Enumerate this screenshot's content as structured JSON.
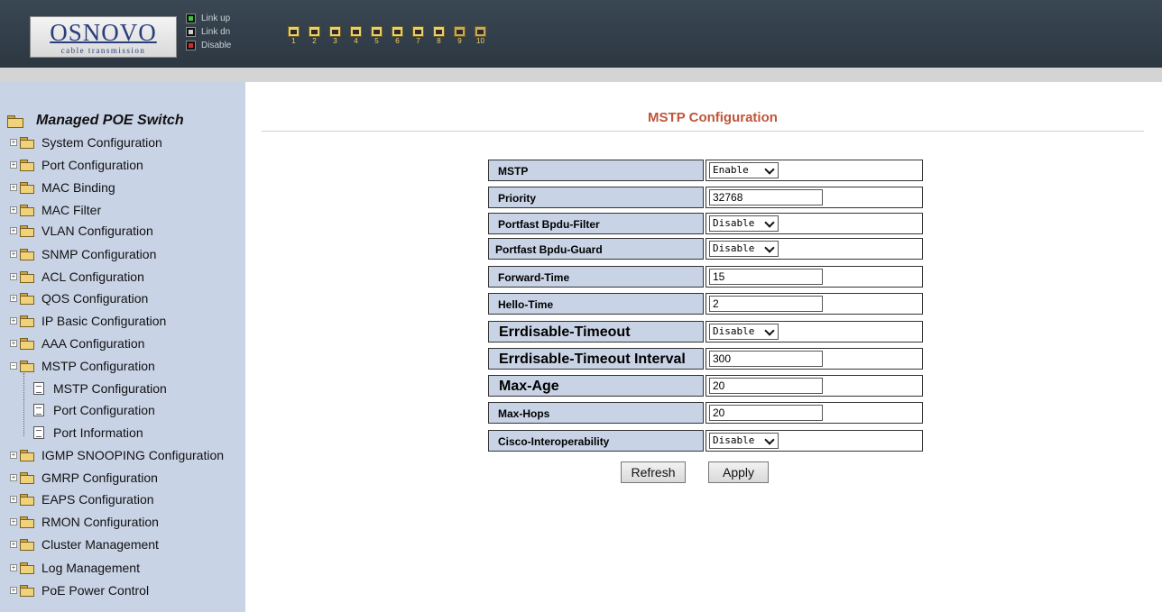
{
  "header": {
    "logo": "OSNOVO",
    "logo_subtitle": "cable transmission",
    "legend": [
      {
        "label": "Link up",
        "icon": "port-link-up-icon"
      },
      {
        "label": "Link dn",
        "icon": "port-link-down-icon"
      },
      {
        "label": "Disable",
        "icon": "port-disabled-icon"
      }
    ],
    "ports": [
      "1",
      "2",
      "3",
      "4",
      "5",
      "6",
      "7",
      "8",
      "9",
      "10"
    ]
  },
  "sidebar": {
    "root_label": "Managed POE Switch",
    "items": [
      {
        "label": "System Configuration"
      },
      {
        "label": "Port Configuration"
      },
      {
        "label": "MAC Binding"
      },
      {
        "label": "MAC Filter"
      },
      {
        "label": "VLAN Configuration"
      },
      {
        "label": "SNMP Configuration"
      },
      {
        "label": "ACL Configuration"
      },
      {
        "label": "QOS Configuration"
      },
      {
        "label": "IP Basic Configuration"
      },
      {
        "label": "AAA Configuration"
      },
      {
        "label": "MSTP Configuration",
        "expanded": true
      },
      {
        "label": "MSTP Configuration"
      },
      {
        "label": "Port Configuration"
      },
      {
        "label": "Port Information"
      },
      {
        "label": "IGMP SNOOPING Configuration"
      },
      {
        "label": "GMRP Configuration"
      },
      {
        "label": "EAPS Configuration"
      },
      {
        "label": "RMON Configuration"
      },
      {
        "label": "Cluster Management"
      },
      {
        "label": "Log Management"
      },
      {
        "label": "PoE Power Control"
      }
    ]
  },
  "main": {
    "title": "MSTP Configuration",
    "rows": [
      {
        "label": "MSTP",
        "type": "select",
        "value": "Enable"
      },
      {
        "label": "Priority",
        "type": "input",
        "value": "32768"
      },
      {
        "label": "Portfast Bpdu-Filter",
        "type": "select",
        "value": "Disable"
      },
      {
        "label": "Portfast Bpdu-Guard",
        "type": "select",
        "value": "Disable"
      },
      {
        "label": "Forward-Time",
        "type": "input",
        "value": "15"
      },
      {
        "label": "Hello-Time",
        "type": "input",
        "value": "2"
      },
      {
        "label": "Errdisable-Timeout",
        "type": "select",
        "value": "Disable"
      },
      {
        "label": "Errdisable-Timeout Interval",
        "type": "input",
        "value": "300"
      },
      {
        "label": "Max-Age",
        "type": "input",
        "value": "20"
      },
      {
        "label": "Max-Hops",
        "type": "input",
        "value": "20"
      },
      {
        "label": "Cisco-Interoperability",
        "type": "select",
        "value": "Disable"
      }
    ],
    "refresh_label": "Refresh",
    "apply_label": "Apply"
  }
}
